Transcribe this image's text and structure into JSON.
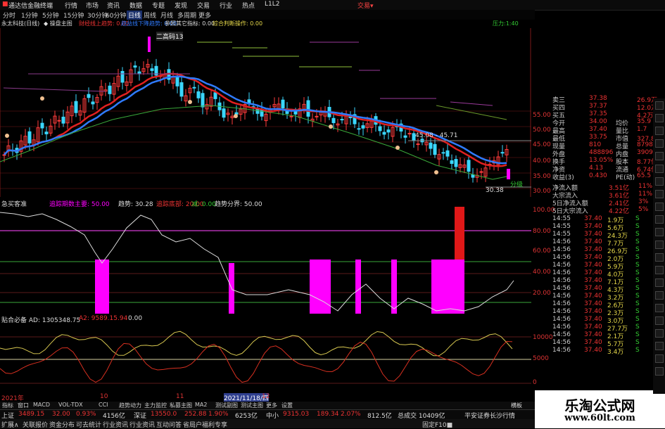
{
  "app": {
    "title": "通达信金融终端",
    "menu": [
      "行情",
      "市场",
      "资讯",
      "数据",
      "专题",
      "发现",
      "交易",
      "行业",
      "热点",
      "L1L2"
    ],
    "right_label": "交易▾"
  },
  "toolbar": {
    "periods": [
      "分时",
      "1分钟",
      "5分钟",
      "15分钟",
      "30分钟",
      "60分钟",
      "日线",
      "周线",
      "月线",
      "多周期",
      "更多"
    ],
    "active": "日线"
  },
  "stock": {
    "name": "永太科技(日线)",
    "indicator": "◆ 操盘主图"
  },
  "ind1": {
    "a": "财经线上趋势: 0.00",
    "b": "趋益线下降趋势: 0.00",
    "c": "参照其它指标: 0.00",
    "d": "综合判断操作: 0.00",
    "e": "压力:1:40"
  },
  "main_axis": [
    "55.00",
    "50.00",
    "45.00",
    "40.00",
    "35.00",
    "30.00"
  ],
  "price_labels": {
    "high": "二高码13",
    "mid": "45.08 - 45.71",
    "low": "30.38",
    "right_tag": "分级"
  },
  "sub1": {
    "title": "急买客准",
    "v1": "追踪期数主要: 50.00",
    "v2": "趋势: 30.28",
    "v3": "追踪底部: 20.00",
    "v4": "减: 0.00",
    "v5": "趋势分界: 50.00",
    "axis": [
      "100.00",
      "80.00",
      "60.00",
      "40.00",
      "20.00"
    ]
  },
  "sub2": {
    "title": "贴合必备 AD: 1305348.75",
    "v2": "A2: 9589.15.94",
    "v3": "0.00",
    "axis": [
      "10000",
      "5000",
      "0"
    ]
  },
  "time_axis": [
    "2021年",
    "10",
    "11",
    "2021/11/18/四",
    "12"
  ],
  "quote": [
    {
      "k": "卖三",
      "v": "37.38",
      "k2": "",
      "v2": "26.9万"
    },
    {
      "k": "买四",
      "v": "37.37",
      "k2": "",
      "v2": "12.0万"
    },
    {
      "k": "买五",
      "v": "37.35",
      "k2": "",
      "v2": "4.2万"
    },
    {
      "k": "今开",
      "v": "34.00",
      "k2": "均价",
      "v2": "35.9"
    },
    {
      "k": "最高",
      "v": "37.40",
      "k2": "量比",
      "v2": "1.7"
    },
    {
      "k": "最低",
      "v": "33.75",
      "k2": "市值",
      "v2": "327.8亿"
    },
    {
      "k": "现量",
      "v": "810",
      "k2": "总量",
      "v2": "879818"
    },
    {
      "k": "外盘",
      "v": "488896",
      "k2": "内盘",
      "v2": "390922"
    },
    {
      "k": "换手",
      "v": "13.05%",
      "k2": "股本",
      "v2": "8.77亿"
    },
    {
      "k": "净资",
      "v": "4.13",
      "k2": "流通",
      "v2": "6.74亿"
    },
    {
      "k": "收益(3)",
      "v": "0.430",
      "k2": "PE(动)",
      "v2": "65.5"
    }
  ],
  "flows": [
    {
      "k": "净流入额",
      "v": "3.51亿",
      "p": "11%"
    },
    {
      "k": "大宗流入",
      "v": "3.61亿",
      "p": "11%"
    },
    {
      "k": "5日净流入额",
      "v": "2.41亿",
      "p": "3%"
    },
    {
      "k": "5日大宗流入",
      "v": "4.22亿",
      "p": "5%"
    }
  ],
  "ticks": [
    {
      "t": "14:55",
      "p": "37.40",
      "v": "1.9万",
      "s": "S"
    },
    {
      "t": "14:55",
      "p": "37.40",
      "v": "5.6万",
      "s": "S"
    },
    {
      "t": "14:55",
      "p": "37.40",
      "v": "24.3万",
      "s": "S"
    },
    {
      "t": "14:56",
      "p": "37.40",
      "v": "7.7万",
      "s": "S"
    },
    {
      "t": "14:56",
      "p": "37.40",
      "v": "26.9万",
      "s": "S"
    },
    {
      "t": "14:56",
      "p": "37.40",
      "v": "2.0万",
      "s": "S"
    },
    {
      "t": "14:56",
      "p": "37.40",
      "v": "5.9万",
      "s": "S"
    },
    {
      "t": "14:56",
      "p": "37.40",
      "v": "4.0万",
      "s": "S"
    },
    {
      "t": "14:56",
      "p": "37.40",
      "v": "7.1万",
      "s": "S"
    },
    {
      "t": "14:56",
      "p": "37.40",
      "v": "4.3万",
      "s": "S"
    },
    {
      "t": "14:56",
      "p": "37.40",
      "v": "3.2万",
      "s": "S"
    },
    {
      "t": "14:56",
      "p": "37.40",
      "v": "2.6万",
      "s": "S"
    },
    {
      "t": "14:56",
      "p": "37.40",
      "v": "2.3万",
      "s": "S"
    },
    {
      "t": "14:56",
      "p": "37.40",
      "v": "3.0万",
      "s": "S"
    },
    {
      "t": "14:56",
      "p": "37.40",
      "v": "27.7万",
      "s": "S"
    },
    {
      "t": "14:56",
      "p": "37.40",
      "v": "2.1万",
      "s": "S"
    },
    {
      "t": "14:56",
      "p": "37.40",
      "v": "5.7万",
      "s": "S"
    },
    {
      "t": "14:56",
      "p": "37.40",
      "v": "3.4万",
      "s": "S"
    }
  ],
  "tabs": [
    "指标",
    "窗口",
    "MACD",
    "VOL-TDX",
    "CCI",
    "趋势动力",
    "主力监控",
    "私募主图",
    "MA2",
    "测试副图",
    "测试主图",
    "更多",
    "设置"
  ],
  "tabs_right": "横板",
  "status": [
    {
      "k": "上证",
      "v": "3489.15",
      "c": "32.00",
      "p": "0.93%",
      "a": "4156亿"
    },
    {
      "k": "深证",
      "v": "13550.0",
      "c": "252.88",
      "p": "1.90%",
      "a": "6253亿"
    },
    {
      "k": "中小",
      "v": "9315.03",
      "c": "189.34",
      "p": "2.07%",
      "a": "812.5亿"
    }
  ],
  "status_extra": "总成交 10409亿",
  "status_right": "平安证券长沙行情",
  "bottom": [
    "扩展∧",
    "关联报价",
    "资金分布",
    "可去统计",
    "行业资讯",
    "行业资讯",
    "互动问答",
    "省局户福利专享"
  ],
  "bottom_right": "固定F10■",
  "watermark": {
    "cn": "乐淘公式网",
    "url": "www.60lt.com"
  },
  "colors": {
    "up": "#ff3b3b",
    "down": "#3ad7ff",
    "magenta": "#ff00ff",
    "blueMA": "#2f7bff",
    "redMA": "#e02020",
    "green": "#3aa83a"
  }
}
